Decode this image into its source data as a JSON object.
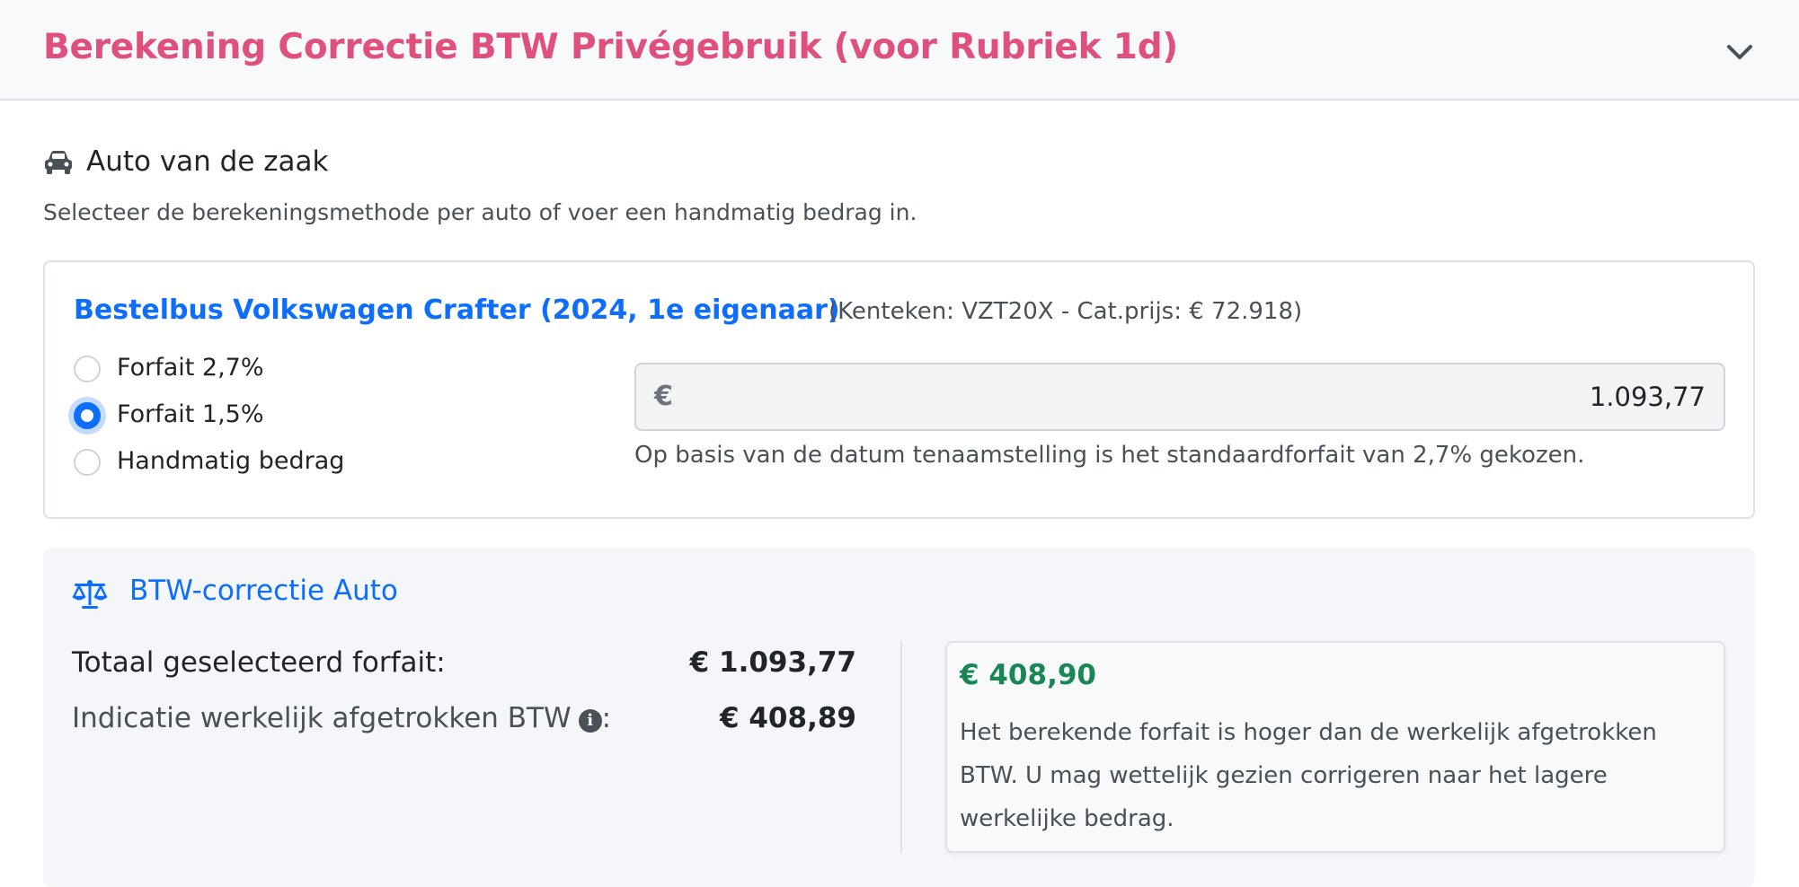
{
  "header": {
    "title": "Berekening Correctie BTW Privégebruik (voor Rubriek 1d)",
    "toggle_icon": "chevron-down-icon"
  },
  "section": {
    "icon": "car-icon",
    "title": "Auto van de zaak",
    "description": "Selecteer de berekeningsmethode per auto of voer een handmatig bedrag in."
  },
  "car": {
    "name": "Bestelbus Volkswagen Crafter (2024, 1e eigenaar)",
    "meta": "(Kenteken: VZT20X - Cat.prijs: € 72.918)",
    "options": [
      {
        "label": "Forfait 2,7%",
        "checked": false
      },
      {
        "label": "Forfait 1,5%",
        "checked": true
      },
      {
        "label": "Handmatig bedrag",
        "checked": false
      }
    ],
    "currency_prefix": "€",
    "amount_value": "1.093,77",
    "help_text": "Op basis van de datum tenaamstelling is het standaardforfait van 2,7% gekozen."
  },
  "correction": {
    "icon": "scale-balance-icon",
    "title": "BTW-correctie Auto",
    "rows": [
      {
        "label": "Totaal geselecteerd forfait:",
        "value": "€ 1.093,77"
      },
      {
        "label": "Indicatie werkelijk afgetrokken BTW",
        "suffix": ":",
        "value": "€ 408,89"
      }
    ],
    "advice_amount": "€ 408,90",
    "advice_text": "Het berekende forfait is hoger dan de werkelijk afgetrokken BTW. U mag wettelijk gezien corrigeren naar het lagere werkelijke bedrag."
  },
  "colors": {
    "title_pink": "#e0507f",
    "primary_blue": "#0d6efd",
    "success_green": "#198754"
  }
}
